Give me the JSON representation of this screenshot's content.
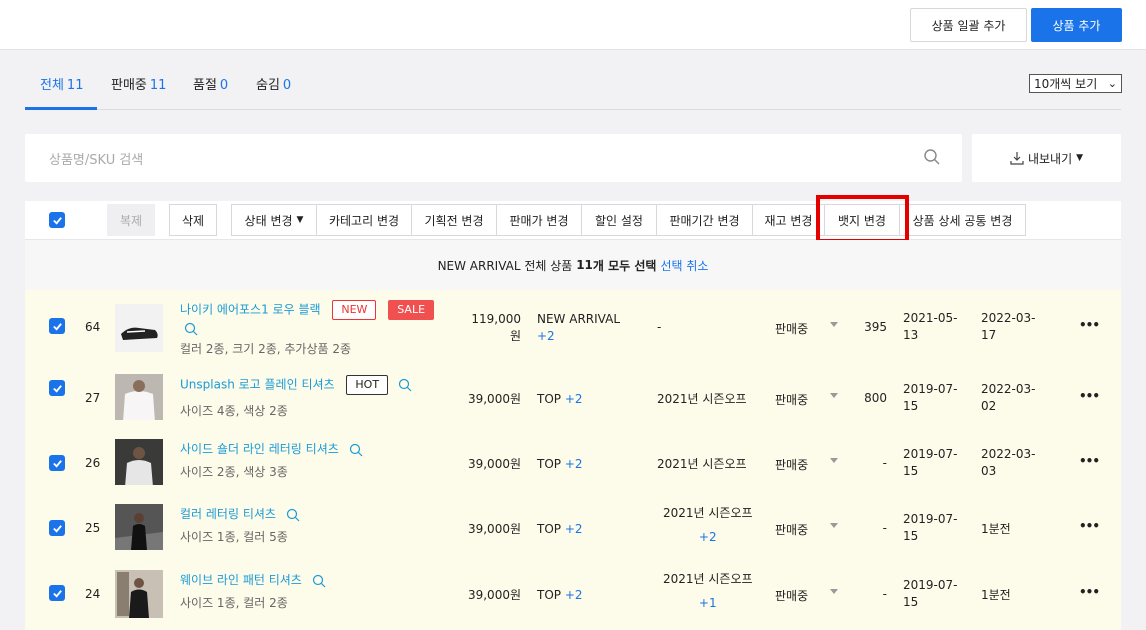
{
  "header": {
    "bulk_add_label": "상품 일괄 추가",
    "add_label": "상품 추가"
  },
  "tabs": [
    {
      "label": "전체",
      "count": "11"
    },
    {
      "label": "판매중",
      "count": "11"
    },
    {
      "label": "품절",
      "count": "0"
    },
    {
      "label": "숨김",
      "count": "0"
    }
  ],
  "per_page": "10개씩 보기",
  "search": {
    "placeholder": "상품명/SKU 검색"
  },
  "export_label": "내보내기",
  "actions": {
    "copy": "복제",
    "delete": "삭제",
    "status": "상태 변경",
    "category": "카테고리 변경",
    "promo": "기획전 변경",
    "price": "판매가 변경",
    "discount": "할인 설정",
    "period": "판매기간 변경",
    "stock": "재고 변경",
    "badge": "뱃지 변경",
    "detail": "상품 상세 공통 변경"
  },
  "selection": {
    "prefix": "NEW ARRIVAL 전체 상품",
    "count": "11",
    "suffix": "개 모두 선택",
    "cancel": "선택 취소"
  },
  "products": [
    {
      "idx": "64",
      "name": "나이키 에어포스1 로우 블랙",
      "badges": [
        "NEW",
        "SALE"
      ],
      "sub": "컬러 2종, 크기 2종, 추가상품 2종",
      "price1": "119,000",
      "price2": "원",
      "cat": "NEW ARRIVAL",
      "cat_plus": "+2",
      "plan": "-",
      "plan_plus": "",
      "status": "판매중",
      "stock": "395",
      "d1a": "2021-05-",
      "d1b": "13",
      "d2a": "2022-03-",
      "d2b": "17"
    },
    {
      "idx": "27",
      "name": "Unsplash 로고 플레인 티셔츠",
      "badges": [
        "HOT"
      ],
      "sub": "사이즈 4종, 색상 2종",
      "price1": "39,000원",
      "price2": "",
      "cat": "TOP",
      "cat_plus": "+2",
      "plan": "2021년 시즌오프",
      "plan_plus": "",
      "status": "판매중",
      "stock": "800",
      "d1a": "2019-07-",
      "d1b": "15",
      "d2a": "2022-03-",
      "d2b": "02"
    },
    {
      "idx": "26",
      "name": "사이드 숄더 라인 레터링 티셔츠",
      "badges": [],
      "sub": "사이즈 2종, 색상 3종",
      "price1": "39,000원",
      "price2": "",
      "cat": "TOP",
      "cat_plus": "+2",
      "plan": "2021년 시즌오프",
      "plan_plus": "",
      "status": "판매중",
      "stock": "-",
      "d1a": "2019-07-",
      "d1b": "15",
      "d2a": "2022-03-",
      "d2b": "03"
    },
    {
      "idx": "25",
      "name": "컬러 레터링 티셔츠",
      "badges": [],
      "sub": "사이즈 1종, 컬러 5종",
      "price1": "39,000원",
      "price2": "",
      "cat": "TOP",
      "cat_plus": "+2",
      "plan": "2021년 시즌오프",
      "plan_plus": "+2",
      "status": "판매중",
      "stock": "-",
      "d1a": "2019-07-",
      "d1b": "15",
      "d2a": "1분전",
      "d2b": ""
    },
    {
      "idx": "24",
      "name": "웨이브 라인 패턴 티셔츠",
      "badges": [],
      "sub": "사이즈 1종, 컬러 2종",
      "price1": "39,000원",
      "price2": "",
      "cat": "TOP",
      "cat_plus": "+2",
      "plan": "2021년 시즌오프",
      "plan_plus": "+1",
      "status": "판매중",
      "stock": "-",
      "d1a": "2019-07-",
      "d1b": "15",
      "d2a": "1분전",
      "d2b": ""
    }
  ],
  "colors": {
    "accent": "#1a73e8",
    "highlight": "#e50000",
    "row_bg": "#fdfbe9"
  }
}
